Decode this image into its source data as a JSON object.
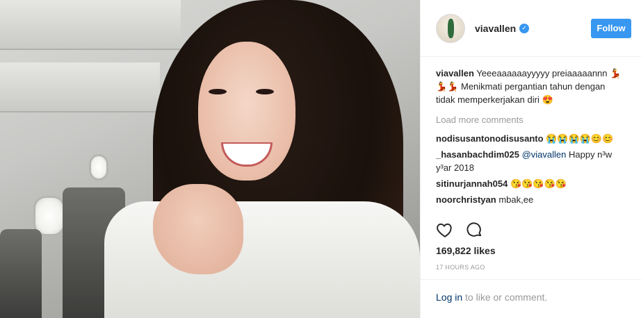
{
  "post": {
    "username": "viavallen",
    "follow_label": "Follow",
    "caption_user": "viavallen",
    "caption_text": "Yeeeaaaaaayyyyy preiaaaaannn 💃💃💃 Menikmati pergantian tahun dengan tidak memperkerjakan diri 😍",
    "load_more": "Load more comments",
    "comments": [
      {
        "user": "nodisusantonodisusanto",
        "text": "😭😭😭😭😊😊",
        "mention": ""
      },
      {
        "user": "_hasanbachdim025",
        "mention": "@viavallen",
        "text": "Happy n³w y³ar 2018"
      },
      {
        "user": "sitinurjannah054",
        "text": "😘😘😘😘😘",
        "mention": ""
      },
      {
        "user": "noorchristyan",
        "text": "mbak,ee",
        "mention": ""
      }
    ],
    "likes": "169,822 likes",
    "timestamp": "17 HOURS AGO",
    "login_link": "Log in",
    "login_suffix": " to like or comment."
  },
  "icons": {
    "verified": "verified-badge-icon",
    "like": "heart-icon",
    "comment": "comment-bubble-icon"
  },
  "colors": {
    "accent": "#3897f0",
    "link": "#003569",
    "muted": "#999999",
    "text": "#262626"
  }
}
